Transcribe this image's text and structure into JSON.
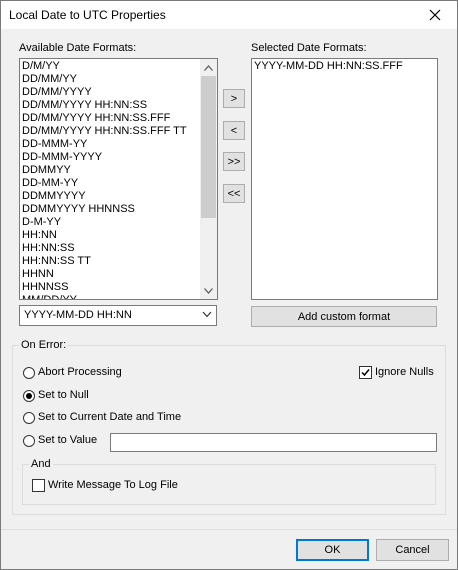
{
  "window": {
    "title": "Local Date to UTC Properties"
  },
  "available": {
    "label": "Available Date Formats:",
    "items": [
      "D/M/YY",
      "DD/MM/YY",
      "DD/MM/YYYY",
      "DD/MM/YYYY HH:NN:SS",
      "DD/MM/YYYY HH:NN:SS.FFF",
      "DD/MM/YYYY HH:NN:SS.FFF TT",
      "DD-MMM-YY",
      "DD-MMM-YYYY",
      "DDMMYY",
      "DD-MM-YY",
      "DDMMYYYY",
      "DDMMYYYY HHNNSS",
      "D-M-YY",
      "HH:NN",
      "HH:NN:SS",
      "HH:NN:SS TT",
      "HHNN",
      "HHNNSS",
      "MM/DD/YY"
    ]
  },
  "selected": {
    "label": "Selected Date Formats:",
    "items": [
      "YYYY-MM-DD HH:NN:SS.FFF"
    ]
  },
  "move_buttons": {
    "add": ">",
    "remove": "<",
    "add_all": ">>",
    "remove_all": "<<"
  },
  "custom_format": {
    "value": "YYYY-MM-DD HH:NN",
    "button": "Add custom format"
  },
  "on_error": {
    "label": "On Error:",
    "abort": "Abort Processing",
    "set_null": "Set to Null",
    "set_current": "Set to Current Date and Time",
    "set_value": "Set to Value",
    "set_value_text": "",
    "ignore_nulls": "Ignore Nulls",
    "and_label": "And",
    "write_log": "Write Message To Log File"
  },
  "footer": {
    "ok": "OK",
    "cancel": "Cancel"
  }
}
